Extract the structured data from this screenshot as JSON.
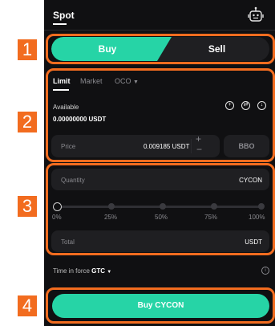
{
  "header": {
    "title": "Spot",
    "bot_icon": "robot-icon"
  },
  "side_tabs": {
    "buy_label": "Buy",
    "sell_label": "Sell"
  },
  "order_types": {
    "limit": "Limit",
    "market": "Market",
    "oco": "OCO"
  },
  "balance": {
    "label": "Available",
    "value": "0.00000000 USDT"
  },
  "price": {
    "label": "Price",
    "value": "0.009185 USDT",
    "bbo_label": "BBO"
  },
  "quantity": {
    "label": "Quantity",
    "unit": "CYCON"
  },
  "slider": {
    "ticks": [
      "0%",
      "25%",
      "50%",
      "75%",
      "100%"
    ],
    "value": 0
  },
  "total": {
    "label": "Total",
    "unit": "USDT"
  },
  "time_in_force": {
    "label": "Time in force",
    "value": "GTC"
  },
  "submit": {
    "label": "Buy CYCON"
  },
  "annotations": {
    "step1": "1",
    "step2": "2",
    "step3": "3",
    "step4": "4"
  },
  "colors": {
    "accent": "#26d4a6",
    "highlight": "#f26c1f",
    "background": "#101012"
  }
}
